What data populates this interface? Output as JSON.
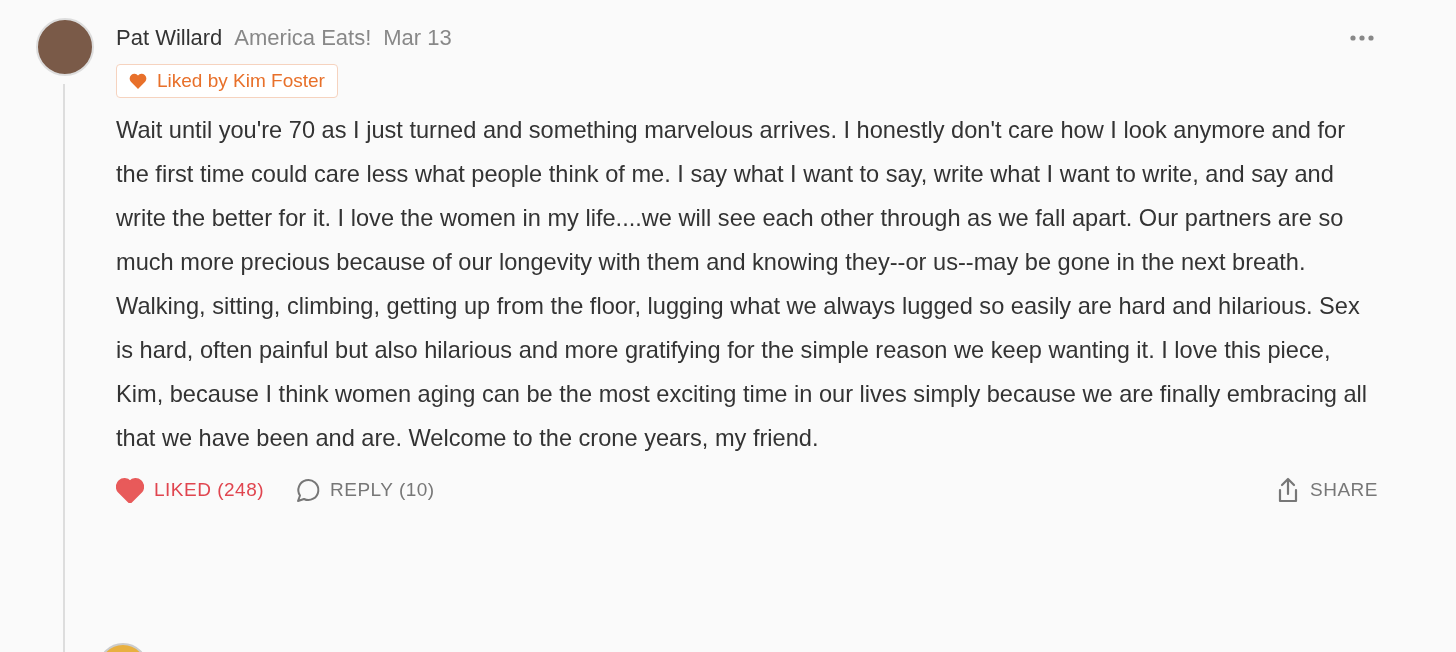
{
  "comment": {
    "author": "Pat Willard",
    "publication": "America Eats!",
    "date": "Mar 13",
    "liked_by": "Liked by Kim Foster",
    "body": "Wait until you're 70 as I just turned and something marvelous arrives. I honestly don't care how I look anymore and for the first time could care less what people think of me. I say what I want to say, write what I want to write, and say and write the better for it. I love the women in my life....we will see each other through as we fall apart. Our partners are so much more precious because of our longevity with them and knowing they--or us--may be gone in the next breath. Walking, sitting, climbing, getting up from the floor, lugging what we always lugged so easily are hard and hilarious. Sex is hard, often painful but also hilarious and more gratifying for the simple reason we keep wanting it. I love this piece, Kim, because I think women aging can be the most exciting time in our lives simply because we are finally embracing all that we have been and are. Welcome to the crone years, my friend.",
    "like_label": "LIKED (248)",
    "liked": true,
    "reply_label": "REPLY (10)",
    "share_label": "SHARE"
  }
}
